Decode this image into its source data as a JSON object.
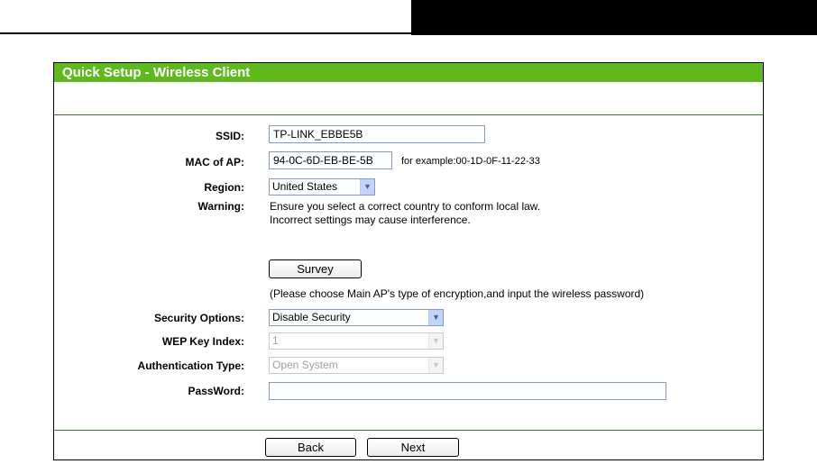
{
  "header": {
    "title": "Quick Setup - Wireless Client"
  },
  "form": {
    "ssid": {
      "label": "SSID:",
      "value": "TP-LINK_EBBE5B"
    },
    "mac": {
      "label": "MAC of AP:",
      "value": "94-0C-6D-EB-BE-5B",
      "hint": "for example:00-1D-0F-11-22-33"
    },
    "region": {
      "label": "Region:",
      "value": "United States"
    },
    "warning": {
      "label": "Warning:",
      "line1": "Ensure you select a correct country to conform local law.",
      "line2": "Incorrect settings may cause interference."
    },
    "survey": {
      "button_label": "Survey",
      "note": "(Please choose Main AP's type of encryption,and input the wireless password)"
    },
    "security": {
      "label": "Security Options:",
      "value": "Disable Security"
    },
    "wep_key": {
      "label": "WEP Key Index:",
      "value": "1",
      "disabled": true
    },
    "auth_type": {
      "label": "Authentication Type:",
      "value": "Open System",
      "disabled": true
    },
    "password": {
      "label": "PassWord:",
      "value": ""
    }
  },
  "footer": {
    "back_label": "Back",
    "next_label": "Next"
  },
  "colors": {
    "header_bg": "#5fb91e",
    "divider": "#2f7a2a"
  }
}
